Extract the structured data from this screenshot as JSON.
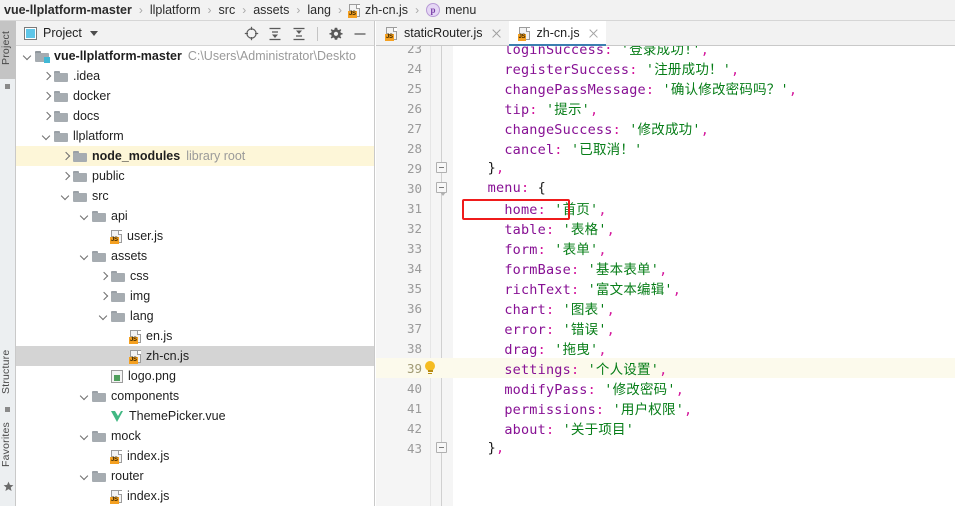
{
  "breadcrumb": {
    "items": [
      {
        "label": "vue-llplatform-master",
        "icon": "none",
        "bold": true
      },
      {
        "label": "llplatform",
        "icon": "none",
        "bold": false
      },
      {
        "label": "src",
        "icon": "none",
        "bold": false
      },
      {
        "label": "assets",
        "icon": "none",
        "bold": false
      },
      {
        "label": "lang",
        "icon": "none",
        "bold": false
      },
      {
        "label": "zh-cn.js",
        "icon": "js-file-icon",
        "bold": false
      },
      {
        "label": "menu",
        "icon": "property-icon",
        "bold": false
      }
    ],
    "separator": "›"
  },
  "tool_strip": {
    "tabs": [
      {
        "label": "Project",
        "active": true
      },
      {
        "label": "Structure",
        "active": false
      },
      {
        "label": "Favorites",
        "active": false
      }
    ]
  },
  "project_panel": {
    "title": "Project",
    "window_icon": "project-window-icon",
    "dropdown_icon": "chevron-down-icon",
    "actions": [
      {
        "name": "select-opened-file-icon",
        "tooltip": "Select Opened File"
      },
      {
        "name": "expand-all-icon",
        "tooltip": "Expand All"
      },
      {
        "name": "collapse-all-icon",
        "tooltip": "Collapse All"
      },
      {
        "name": "settings-gear-icon",
        "tooltip": "Settings"
      },
      {
        "name": "hide-icon",
        "tooltip": "Hide"
      }
    ],
    "tree": [
      {
        "label": "vue-llplatform-master",
        "indent": 0,
        "arrow": "down",
        "icon": "module-folder",
        "bold": true,
        "suffix": "C:\\Users\\Administrator\\Deskto",
        "suffix_kind": "path",
        "state": "normal"
      },
      {
        "label": ".idea",
        "indent": 1,
        "arrow": "right",
        "icon": "folder",
        "bold": false,
        "suffix": "",
        "suffix_kind": "",
        "state": "normal"
      },
      {
        "label": "docker",
        "indent": 1,
        "arrow": "right",
        "icon": "folder",
        "bold": false,
        "suffix": "",
        "suffix_kind": "",
        "state": "normal"
      },
      {
        "label": "docs",
        "indent": 1,
        "arrow": "right",
        "icon": "folder",
        "bold": false,
        "suffix": "",
        "suffix_kind": "",
        "state": "normal"
      },
      {
        "label": "llplatform",
        "indent": 1,
        "arrow": "down",
        "icon": "folder",
        "bold": false,
        "suffix": "",
        "suffix_kind": "",
        "state": "normal"
      },
      {
        "label": "node_modules",
        "indent": 2,
        "arrow": "right",
        "icon": "folder",
        "bold": true,
        "suffix": "library root",
        "suffix_kind": "tag",
        "state": "library"
      },
      {
        "label": "public",
        "indent": 2,
        "arrow": "right",
        "icon": "folder",
        "bold": false,
        "suffix": "",
        "suffix_kind": "",
        "state": "normal"
      },
      {
        "label": "src",
        "indent": 2,
        "arrow": "down",
        "icon": "folder",
        "bold": false,
        "suffix": "",
        "suffix_kind": "",
        "state": "normal"
      },
      {
        "label": "api",
        "indent": 3,
        "arrow": "down",
        "icon": "folder",
        "bold": false,
        "suffix": "",
        "suffix_kind": "",
        "state": "normal"
      },
      {
        "label": "user.js",
        "indent": 4,
        "arrow": "none",
        "icon": "js",
        "bold": false,
        "suffix": "",
        "suffix_kind": "",
        "state": "normal"
      },
      {
        "label": "assets",
        "indent": 3,
        "arrow": "down",
        "icon": "folder",
        "bold": false,
        "suffix": "",
        "suffix_kind": "",
        "state": "normal"
      },
      {
        "label": "css",
        "indent": 4,
        "arrow": "right",
        "icon": "folder",
        "bold": false,
        "suffix": "",
        "suffix_kind": "",
        "state": "normal"
      },
      {
        "label": "img",
        "indent": 4,
        "arrow": "right",
        "icon": "folder",
        "bold": false,
        "suffix": "",
        "suffix_kind": "",
        "state": "normal"
      },
      {
        "label": "lang",
        "indent": 4,
        "arrow": "down",
        "icon": "folder",
        "bold": false,
        "suffix": "",
        "suffix_kind": "",
        "state": "normal"
      },
      {
        "label": "en.js",
        "indent": 5,
        "arrow": "none",
        "icon": "js",
        "bold": false,
        "suffix": "",
        "suffix_kind": "",
        "state": "normal"
      },
      {
        "label": "zh-cn.js",
        "indent": 5,
        "arrow": "none",
        "icon": "js",
        "bold": false,
        "suffix": "",
        "suffix_kind": "",
        "state": "selected"
      },
      {
        "label": "logo.png",
        "indent": 4,
        "arrow": "none",
        "icon": "png",
        "bold": false,
        "suffix": "",
        "suffix_kind": "",
        "state": "normal"
      },
      {
        "label": "components",
        "indent": 3,
        "arrow": "down",
        "icon": "folder",
        "bold": false,
        "suffix": "",
        "suffix_kind": "",
        "state": "normal"
      },
      {
        "label": "ThemePicker.vue",
        "indent": 4,
        "arrow": "none",
        "icon": "vue",
        "bold": false,
        "suffix": "",
        "suffix_kind": "",
        "state": "normal"
      },
      {
        "label": "mock",
        "indent": 3,
        "arrow": "down",
        "icon": "folder",
        "bold": false,
        "suffix": "",
        "suffix_kind": "",
        "state": "normal"
      },
      {
        "label": "index.js",
        "indent": 4,
        "arrow": "none",
        "icon": "js",
        "bold": false,
        "suffix": "",
        "suffix_kind": "",
        "state": "normal"
      },
      {
        "label": "router",
        "indent": 3,
        "arrow": "down",
        "icon": "folder",
        "bold": false,
        "suffix": "",
        "suffix_kind": "",
        "state": "normal"
      },
      {
        "label": "index.js",
        "indent": 4,
        "arrow": "none",
        "icon": "js",
        "bold": false,
        "suffix": "",
        "suffix_kind": "",
        "state": "normal"
      }
    ]
  },
  "editor": {
    "tabs": [
      {
        "label": "staticRouter.js",
        "icon": "js-file-icon",
        "active": false,
        "close_icon": "close-icon"
      },
      {
        "label": "zh-cn.js",
        "icon": "js-file-icon",
        "active": true,
        "close_icon": "close-icon"
      }
    ],
    "caret_line": 39,
    "annotation": {
      "name": "red-highlight-box",
      "target_line": 31,
      "color": "#ef1b1b"
    },
    "code_lines": [
      {
        "n": 23,
        "text": "    loginSuccess: '登录成功!',",
        "fold": "none",
        "bulb": false,
        "clipped_top": true
      },
      {
        "n": 24,
        "text": "    registerSuccess: '注册成功！',",
        "fold": "none",
        "bulb": false
      },
      {
        "n": 25,
        "text": "    changePassMessage: '确认修改密码吗？',",
        "fold": "none",
        "bulb": false
      },
      {
        "n": 26,
        "text": "    tip: '提示',",
        "fold": "none",
        "bulb": false
      },
      {
        "n": 27,
        "text": "    changeSuccess: '修改成功',",
        "fold": "none",
        "bulb": false
      },
      {
        "n": 28,
        "text": "    cancel: '已取消！'",
        "fold": "none",
        "bulb": false
      },
      {
        "n": 29,
        "text": "  },",
        "fold": "end",
        "bulb": false
      },
      {
        "n": 30,
        "text": "  menu: {",
        "fold": "start",
        "bulb": false
      },
      {
        "n": 31,
        "text": "    home: '首页',",
        "fold": "none",
        "bulb": false
      },
      {
        "n": 32,
        "text": "    table: '表格',",
        "fold": "none",
        "bulb": false
      },
      {
        "n": 33,
        "text": "    form: '表单',",
        "fold": "none",
        "bulb": false
      },
      {
        "n": 34,
        "text": "    formBase: '基本表单',",
        "fold": "none",
        "bulb": false
      },
      {
        "n": 35,
        "text": "    richText: '富文本编辑',",
        "fold": "none",
        "bulb": false
      },
      {
        "n": 36,
        "text": "    chart: '图表',",
        "fold": "none",
        "bulb": false
      },
      {
        "n": 37,
        "text": "    error: '错误',",
        "fold": "none",
        "bulb": false
      },
      {
        "n": 38,
        "text": "    drag: '拖曳',",
        "fold": "none",
        "bulb": false
      },
      {
        "n": 39,
        "text": "    settings: '个人设置',",
        "fold": "none",
        "bulb": true
      },
      {
        "n": 40,
        "text": "    modifyPass: '修改密码',",
        "fold": "none",
        "bulb": false
      },
      {
        "n": 41,
        "text": "    permissions: '用户权限',",
        "fold": "none",
        "bulb": false
      },
      {
        "n": 42,
        "text": "    about: '关于项目'",
        "fold": "none",
        "bulb": false
      },
      {
        "n": 43,
        "text": "  },",
        "fold": "end",
        "bulb": false
      }
    ]
  },
  "colors": {
    "property": "#871094",
    "string": "#067d17",
    "punctuation": "#d4179c",
    "caret_line_bg": "#fcfaec",
    "library_row_bg": "#fdf6d8",
    "selection_bg": "#d4d4d4",
    "annotation_red": "#ef1b1b",
    "active_tab_underline": "#3c7fb1"
  }
}
